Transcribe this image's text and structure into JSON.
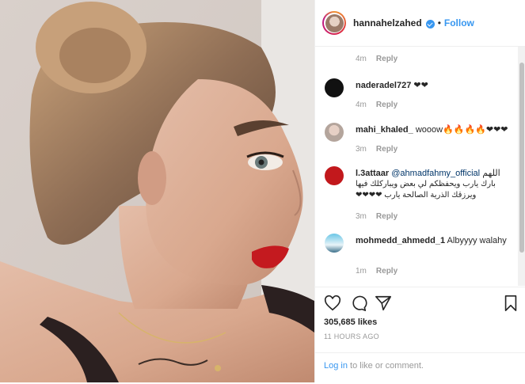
{
  "post": {
    "username": "hannahelzahed",
    "dot": "•",
    "follow_label": "Follow"
  },
  "comments": [
    {
      "meta_time": "4m",
      "reply": "Reply"
    },
    {
      "username": "naderadel727",
      "text": "❤❤",
      "time": "4m",
      "reply": "Reply"
    },
    {
      "username": "mahi_khaled_",
      "text": "wooow🔥🔥🔥🔥❤❤❤",
      "time": "3m",
      "reply": "Reply"
    },
    {
      "username": "l.3attaar",
      "mention": "@ahmadfahmy_official",
      "text_ar1": "اللهم",
      "text_ar2": "بارك يارب ويحفظكم لي بعض ويباركلك فيها",
      "text_ar3": "ويرزقك الذرية الصالحة يارب ❤❤❤❤",
      "time": "3m",
      "reply": "Reply"
    },
    {
      "username": "mohmedd_ahmedd_1",
      "text": "Albyyyy walahy",
      "time": "1m",
      "reply": "Reply"
    }
  ],
  "actions": {
    "likes": "305,685 likes",
    "time_ago": "11 HOURS AGO",
    "login_link": "Log in",
    "login_rest": " to like or comment."
  },
  "colors": {
    "link": "#3897f0",
    "muted": "#999999",
    "text": "#262626",
    "border": "#efefef"
  },
  "icons": [
    "heart-icon",
    "comment-icon",
    "share-icon",
    "bookmark-icon",
    "verified-badge-icon"
  ]
}
